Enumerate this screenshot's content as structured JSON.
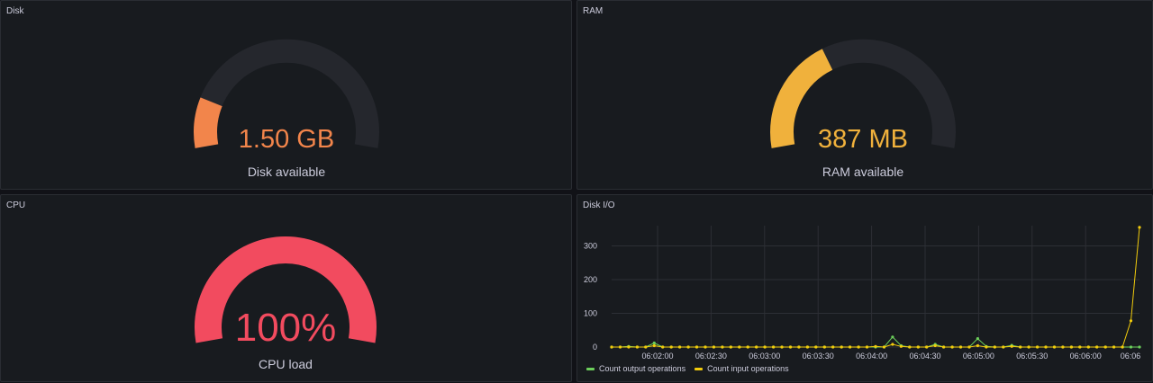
{
  "colors": {
    "background": "#111217",
    "panel": "#181b1f",
    "gauge_track": "#25272d",
    "disk": "#f2854b",
    "ram": "#f0b13c",
    "cpu": "#f24b5f",
    "series_output": "#6ccf5b",
    "series_input": "#f2cc0c"
  },
  "panels": {
    "disk": {
      "title": "Disk",
      "value": "1.50 GB",
      "label": "Disk available",
      "fill_fraction": 0.16
    },
    "ram": {
      "title": "RAM",
      "value": "387 MB",
      "label": "RAM available",
      "fill_fraction": 0.37
    },
    "cpu": {
      "title": "CPU",
      "value": "100%",
      "label": "CPU load",
      "fill_fraction": 1.0
    },
    "diskio": {
      "title": "Disk I/O"
    }
  },
  "chart_data": {
    "type": "line",
    "ylim": [
      0,
      360
    ],
    "yticks": [
      "300",
      "200",
      "100",
      "0"
    ],
    "ytick_values": [
      300,
      200,
      100,
      0
    ],
    "xticks": [
      "06:02:00",
      "06:02:30",
      "06:03:00",
      "06:03:30",
      "06:04:00",
      "06:04:30",
      "06:05:00",
      "06:05:30",
      "06:06:00",
      "06:06"
    ],
    "grid": true,
    "legend_placement": "bottom-left",
    "series": [
      {
        "name": "Count output operations",
        "color": "#6ccf5b",
        "values": [
          0,
          0,
          2,
          0,
          0,
          12,
          0,
          0,
          0,
          0,
          0,
          0,
          0,
          0,
          0,
          0,
          0,
          0,
          0,
          0,
          0,
          0,
          0,
          0,
          0,
          0,
          0,
          0,
          0,
          0,
          0,
          0,
          0,
          30,
          4,
          0,
          0,
          0,
          8,
          0,
          0,
          0,
          0,
          25,
          2,
          0,
          0,
          5,
          0,
          0,
          0,
          0,
          0,
          0,
          0,
          0,
          0,
          0,
          0,
          0,
          0,
          0,
          0
        ]
      },
      {
        "name": "Count input operations",
        "color": "#f2cc0c",
        "values": [
          0,
          0,
          0,
          0,
          0,
          4,
          0,
          0,
          0,
          0,
          0,
          0,
          0,
          0,
          0,
          0,
          0,
          0,
          0,
          0,
          0,
          0,
          0,
          0,
          0,
          0,
          0,
          0,
          0,
          0,
          0,
          2,
          0,
          8,
          2,
          0,
          0,
          0,
          4,
          0,
          0,
          0,
          0,
          4,
          0,
          0,
          0,
          2,
          0,
          0,
          0,
          0,
          0,
          0,
          0,
          0,
          0,
          0,
          0,
          0,
          0,
          78,
          355
        ]
      }
    ]
  }
}
